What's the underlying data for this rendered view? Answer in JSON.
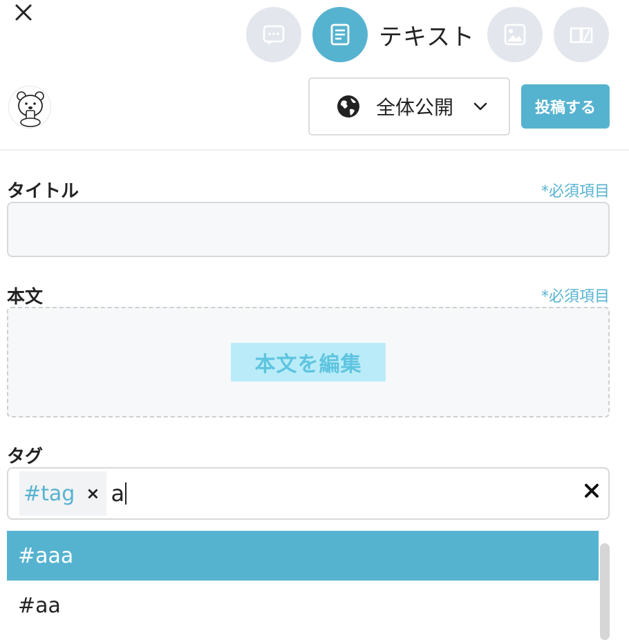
{
  "post_types": {
    "active_label": "テキスト",
    "items": [
      {
        "name": "chat-bubble-icon",
        "active": false
      },
      {
        "name": "document-icon",
        "active": true
      },
      {
        "name": "image-icon",
        "active": false
      },
      {
        "name": "book-icon",
        "active": false
      }
    ]
  },
  "header": {
    "visibility_label": "全体公開",
    "post_button": "投稿する"
  },
  "form": {
    "required_text": "*必須項目",
    "title_label": "タイトル",
    "title_value": "",
    "body_label": "本文",
    "body_edit_button": "本文を編集",
    "tags_label": "タグ",
    "tags": [
      "#tag"
    ],
    "tag_remove_glyph": "×",
    "tag_input_value": "a"
  },
  "suggestions": [
    "#aaa",
    "#aa"
  ],
  "colors": {
    "accent": "#56b3d0",
    "inactive_circle": "#e3e7ed",
    "body_button_bg": "#b9ecf8",
    "body_button_text": "#5ec4e0"
  }
}
